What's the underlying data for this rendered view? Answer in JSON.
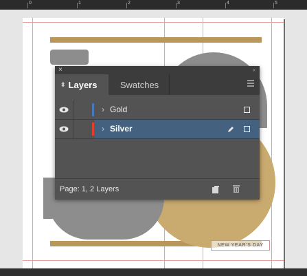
{
  "ruler": {
    "marks": [
      "0",
      "1",
      "2",
      "3",
      "4",
      "5"
    ]
  },
  "document": {
    "label_text": "NEW YEAR'S DAY"
  },
  "layers_panel": {
    "close_glyph": "×",
    "collapse_glyph": "«",
    "tabs": [
      {
        "label": "Layers",
        "active": true
      },
      {
        "label": "Swatches",
        "active": false
      }
    ],
    "layers": [
      {
        "name": "Gold",
        "color": "#4a79b8",
        "visible": true,
        "selected": false
      },
      {
        "name": "Silver",
        "color": "#e2402a",
        "visible": true,
        "selected": true
      }
    ],
    "footer_text": "Page: 1, 2 Layers"
  },
  "colors": {
    "gold": "#b9975b",
    "grey": "#8d8d8d",
    "selection": "#44627f",
    "panel_bg": "#535353"
  },
  "icons": {
    "visibility": "eye-icon",
    "twist": "chevron-right-icon",
    "pen": "pen-icon",
    "new_layer": "new-layer-icon",
    "delete": "trash-icon",
    "menu": "panel-menu-icon"
  }
}
